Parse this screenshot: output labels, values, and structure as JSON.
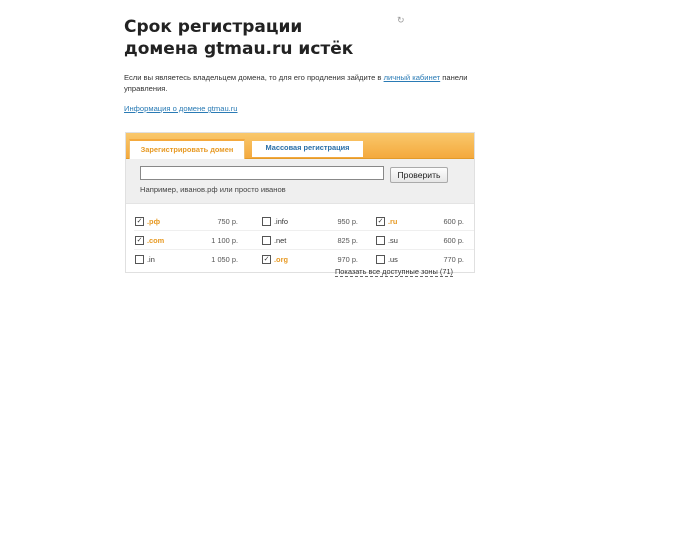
{
  "header": {
    "title": "Срок регистрации домена gtmau.ru истёк",
    "desc_part1": "Если вы являетесь владельцем домена, то для его продления зайдите в ",
    "desc_link": "личный кабинет",
    "desc_part2": " панели управления.",
    "info_link": "Информация о домене gtmau.ru"
  },
  "widget": {
    "tabs": [
      {
        "label": "Зарегистрировать домен",
        "active": true
      },
      {
        "label": "Массовая регистрация",
        "active": false
      }
    ],
    "search": {
      "value": "",
      "button_label": "Проверить",
      "hint": "Например, иванов.рф или просто иванов"
    },
    "zones": [
      {
        "name": ".рф",
        "price": "750 р.",
        "checked": true
      },
      {
        "name": ".info",
        "price": "950 р.",
        "checked": false
      },
      {
        "name": ".ru",
        "price": "600 р.",
        "checked": true
      },
      {
        "name": ".com",
        "price": "1 100 р.",
        "checked": true
      },
      {
        "name": ".net",
        "price": "825 р.",
        "checked": false
      },
      {
        "name": ".su",
        "price": "600 р.",
        "checked": false
      },
      {
        "name": ".in",
        "price": "1 050 р.",
        "checked": false
      },
      {
        "name": ".org",
        "price": "970 р.",
        "checked": true
      },
      {
        "name": ".us",
        "price": "770 р.",
        "checked": false
      }
    ],
    "show_all": "Показать все доступные зоны (71)"
  },
  "colors": {
    "accent_orange": "#f4a93d",
    "link_blue": "#2a7bb5",
    "selected_zone": "#e79a24"
  }
}
